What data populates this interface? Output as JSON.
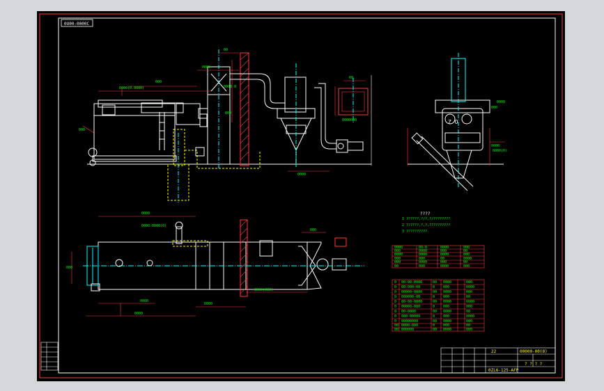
{
  "drawing": {
    "stamp": "0U00-0000C",
    "notes_title": "????",
    "notes": [
      "1  ??????,?/?,?/????????",
      "2  ??????,?,?,??????????",
      "3  ??????????"
    ]
  },
  "title_block": {
    "title_code": "00000-00(0)",
    "drawing_no": "0ZL6-125-AFP",
    "qty": "22",
    "marks": "? ? ? ?"
  },
  "colors": {
    "background": "#000000",
    "border": "#ffffff",
    "dimension": "#ff0000",
    "outline": "#ffffff",
    "centerline": "#00ffff",
    "hidden": "#ffff00",
    "table": "#ff0000",
    "table_text": "#00ff00",
    "wall": "#ff3b3b"
  }
}
